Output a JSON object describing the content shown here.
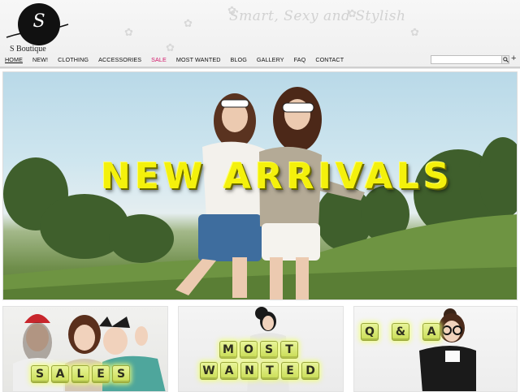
{
  "brand": {
    "monogram": "S",
    "name": "S Boutique",
    "tagline": "Smart, Sexy and Stylish"
  },
  "nav": {
    "items": [
      {
        "label": "HOME",
        "active": true
      },
      {
        "label": "NEW!"
      },
      {
        "label": "CLOTHING"
      },
      {
        "label": "ACCESSORIES"
      },
      {
        "label": "SALE",
        "highlight": true
      },
      {
        "label": "MOST WANTED"
      },
      {
        "label": "BLOG"
      },
      {
        "label": "GALLERY"
      },
      {
        "label": "FAQ"
      },
      {
        "label": "CONTACT"
      }
    ],
    "search_value": "",
    "search_button_icon": "search-icon",
    "plus_icon": "+"
  },
  "hero": {
    "title": "NEW ARRIVALS"
  },
  "tiles": {
    "sales": {
      "letters": [
        "S",
        "A",
        "L",
        "E",
        "S"
      ]
    },
    "most_wanted": {
      "line1": [
        "M",
        "O",
        "S",
        "T"
      ],
      "line2": [
        "W",
        "A",
        "N",
        "T",
        "E",
        "D"
      ]
    },
    "qa": {
      "letters": [
        "Q",
        "&",
        "A"
      ]
    }
  },
  "colors": {
    "accent_sale": "#d2186a",
    "hero_text": "#f4f10c",
    "key_yellow": "#d6e86a"
  }
}
